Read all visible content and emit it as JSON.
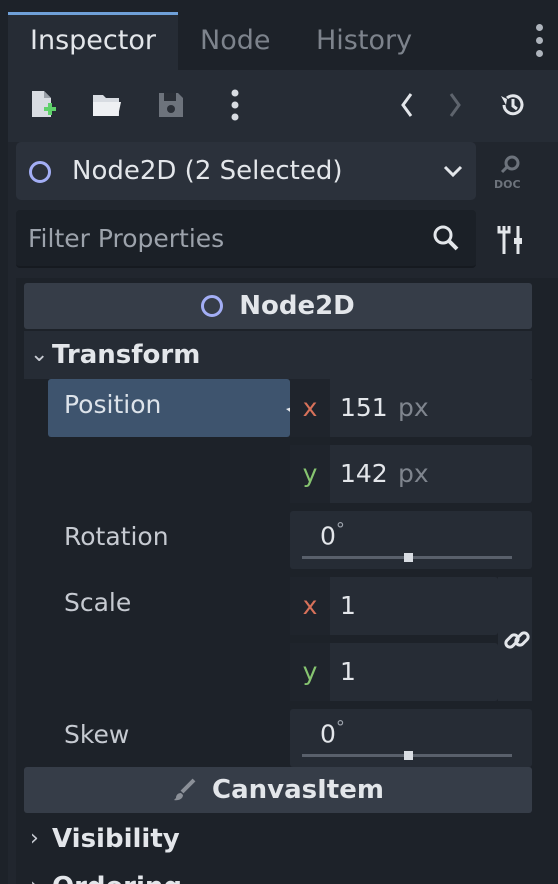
{
  "tabs": [
    {
      "label": "Inspector",
      "active": true
    },
    {
      "label": "Node",
      "active": false
    },
    {
      "label": "History",
      "active": false
    }
  ],
  "toolbar": {
    "icons": [
      "new-resource-icon",
      "open-folder-icon",
      "save-icon",
      "more-menu-icon",
      "history-back-icon",
      "history-forward-icon",
      "object-history-icon"
    ]
  },
  "selector": {
    "label": "Node2D (2 Selected)",
    "doc_icon": "doc-icon"
  },
  "filter": {
    "placeholder": "Filter Properties"
  },
  "sections": {
    "node2d": "Node2D",
    "transform": "Transform",
    "canvas_item": "CanvasItem",
    "visibility": "Visibility",
    "ordering": "Ordering"
  },
  "properties": {
    "position": {
      "label": "Position",
      "x": "151",
      "y": "142",
      "unit": "px"
    },
    "rotation": {
      "label": "Rotation",
      "value": "0",
      "unit": "°"
    },
    "scale": {
      "label": "Scale",
      "x": "1",
      "y": "1"
    },
    "skew": {
      "label": "Skew",
      "value": "0",
      "unit": "°"
    }
  },
  "axes": {
    "x": "x",
    "y": "y"
  },
  "colors": {
    "accent": "#6fa0d8",
    "node_icon": "#a3aef5",
    "axis_x": "#d7715a",
    "axis_y": "#86c470",
    "highlight": "#3e546e"
  }
}
